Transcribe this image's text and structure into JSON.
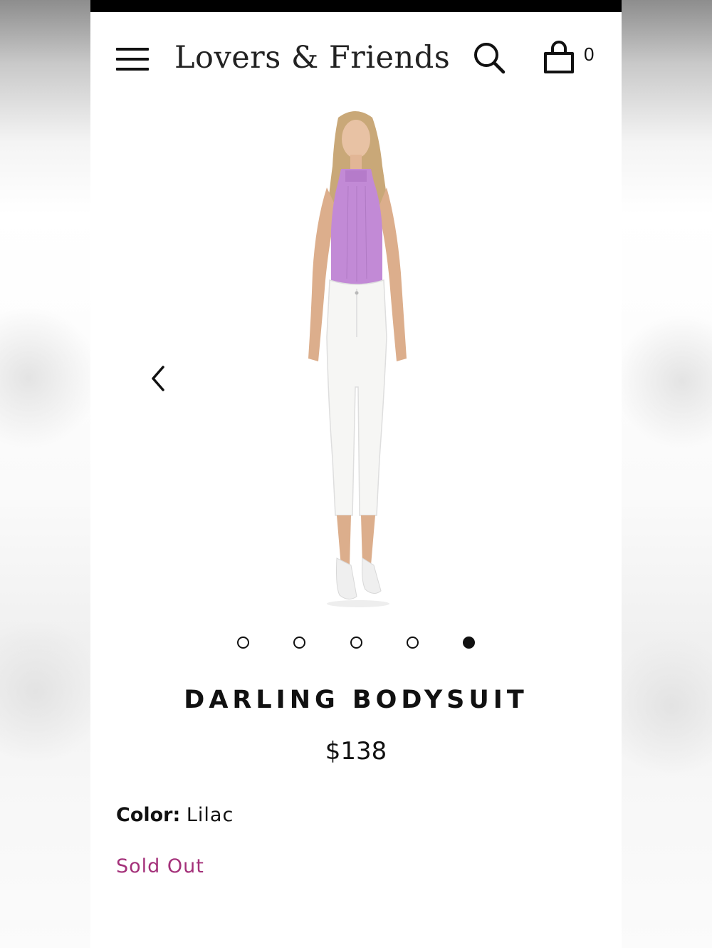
{
  "header": {
    "brand": "Lovers & Friends",
    "cart_count": "0"
  },
  "gallery": {
    "image_count": 5,
    "active_index": 4
  },
  "product": {
    "name": "DARLING BODYSUIT",
    "price": "$138",
    "color_label": "Color:",
    "color_value": "Lilac",
    "availability": "Sold Out"
  },
  "colors": {
    "text": "#111111",
    "sold_out": "#a4317a",
    "top_bar": "#000000",
    "bodysuit": "#c28ad6",
    "jeans": "#f6f6f4"
  },
  "icons": [
    "menu-icon",
    "search-icon",
    "shopping-bag-icon",
    "chevron-left-icon"
  ]
}
